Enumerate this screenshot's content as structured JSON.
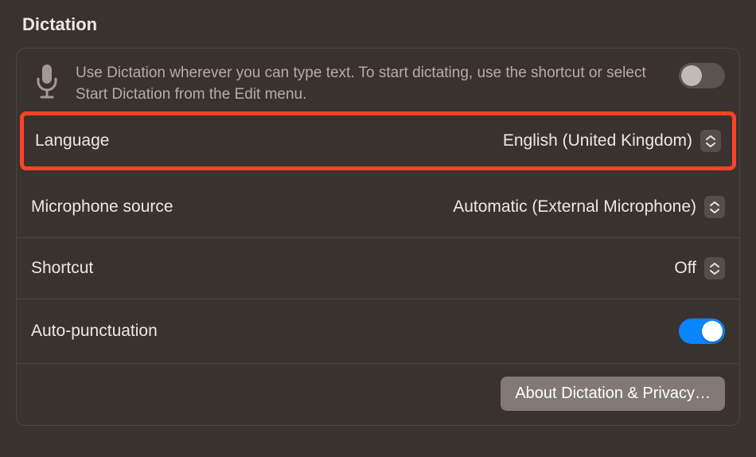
{
  "section_title": "Dictation",
  "intro_text": "Use Dictation wherever you can type text. To start dictating, use the shortcut or select Start Dictation from the Edit menu.",
  "dictation_enabled": false,
  "rows": {
    "language": {
      "label": "Language",
      "value": "English (United Kingdom)"
    },
    "mic_source": {
      "label": "Microphone source",
      "value": "Automatic (External Microphone)"
    },
    "shortcut": {
      "label": "Shortcut",
      "value": "Off"
    },
    "auto_punct": {
      "label": "Auto-punctuation",
      "value": true
    }
  },
  "about_button": "About Dictation & Privacy…",
  "colors": {
    "highlight": "#fe4326",
    "toggle_on": "#0a84ff",
    "bg": "#3a322e"
  }
}
